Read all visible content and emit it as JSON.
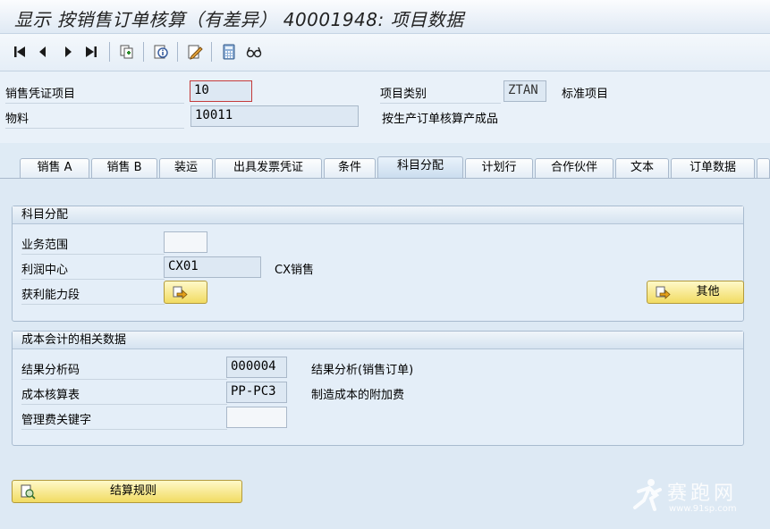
{
  "window": {
    "title": "显示 按销售订单核算（有差异） 40001948: 项目数据"
  },
  "toolbar": {
    "buttons": [
      "first-icon",
      "previous-icon",
      "next-icon",
      "last-icon",
      "document-flow-icon",
      "info-icon",
      "edit-icon",
      "calculator-icon",
      "glasses-icon"
    ]
  },
  "header": {
    "item_label": "销售凭证项目",
    "item_value": "10",
    "category_label": "项目类别",
    "category_value": "ZTAN",
    "category_text": "标准项目",
    "material_label": "物料",
    "material_value": "10011",
    "material_text": "按生产订单核算产成品"
  },
  "tabs": [
    {
      "label": "销售 A",
      "active": false
    },
    {
      "label": "销售 B",
      "active": false
    },
    {
      "label": "装运",
      "active": false
    },
    {
      "label": "出具发票凭证",
      "active": false
    },
    {
      "label": "条件",
      "active": false
    },
    {
      "label": "科目分配",
      "active": true
    },
    {
      "label": "计划行",
      "active": false
    },
    {
      "label": "合作伙伴",
      "active": false
    },
    {
      "label": "文本",
      "active": false
    },
    {
      "label": "订单数据",
      "active": false
    }
  ],
  "account_group": {
    "title": "科目分配",
    "business_area_label": "业务范围",
    "business_area_value": "",
    "profit_center_label": "利润中心",
    "profit_center_value": "CX01",
    "profit_center_text": "CX销售",
    "profitability_label": "获利能力段",
    "other_button": "其他"
  },
  "cost_group": {
    "title": "成本会计的相关数据",
    "results_key_label": "结果分析码",
    "results_key_value": "000004",
    "results_key_text": "结果分析(销售订单)",
    "costing_sheet_label": "成本核算表",
    "costing_sheet_value": "PP-PC3",
    "costing_sheet_text": "制造成本的附加费",
    "overhead_label": "管理费关键字",
    "overhead_value": ""
  },
  "settlement_button": "结算规则",
  "watermark": {
    "text": "赛跑网",
    "url": "www.91sp.com"
  },
  "colors": {
    "accent_yellow": "#f1db62",
    "panel_blue": "#dde9f4",
    "focus_red": "#c43a3a"
  }
}
